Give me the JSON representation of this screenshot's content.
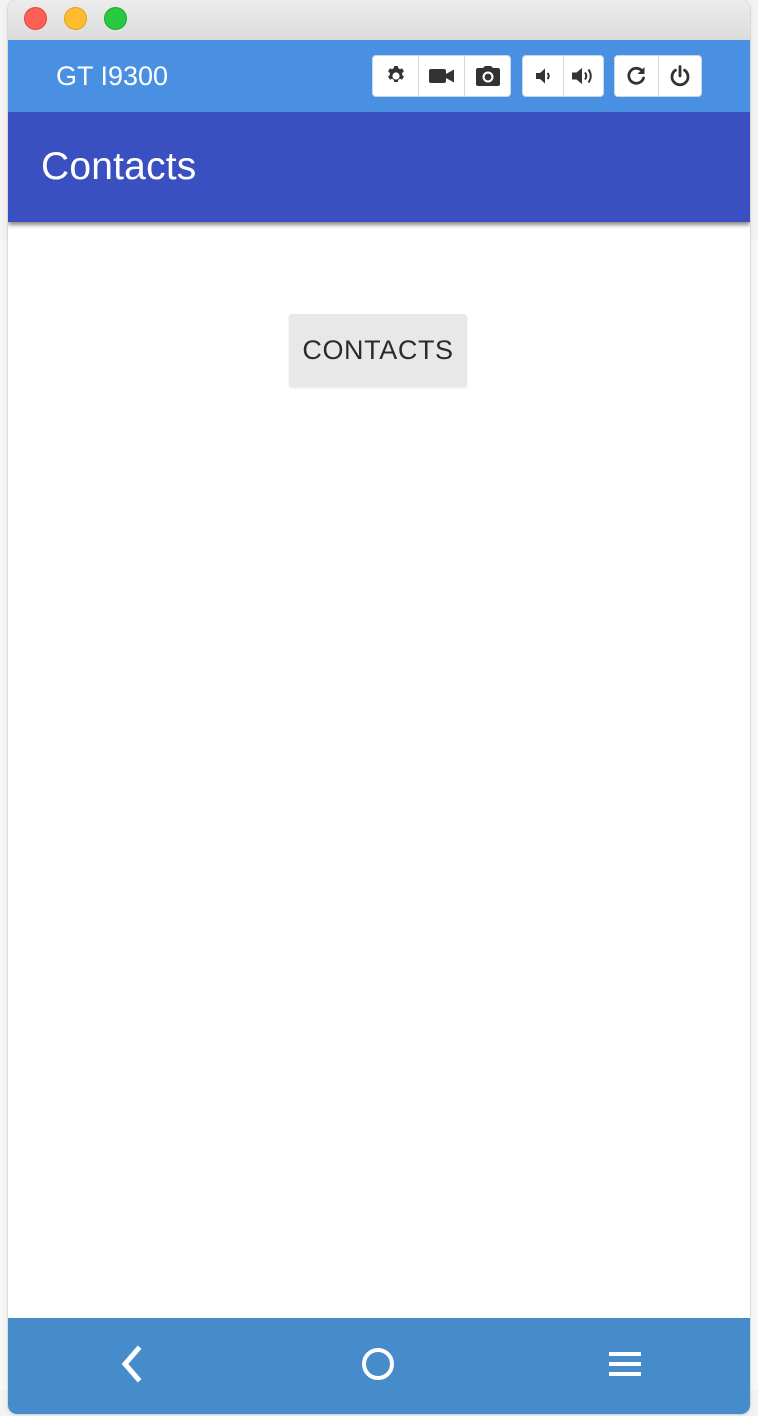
{
  "device": {
    "name": "GT I9300",
    "toolbar": {
      "groups": [
        {
          "buttons": [
            {
              "icon": "settings-icon"
            },
            {
              "icon": "video-camera-icon"
            },
            {
              "icon": "camera-icon"
            }
          ]
        },
        {
          "buttons": [
            {
              "icon": "volume-down-icon"
            },
            {
              "icon": "volume-up-icon"
            }
          ]
        },
        {
          "buttons": [
            {
              "icon": "rotate-icon"
            },
            {
              "icon": "power-icon"
            }
          ]
        }
      ]
    }
  },
  "app": {
    "title": "Contacts",
    "main_button_label": "CONTACTS"
  },
  "navigation": {
    "buttons": [
      {
        "icon": "back-icon"
      },
      {
        "icon": "home-icon"
      },
      {
        "icon": "menu-icon"
      }
    ]
  },
  "colors": {
    "device_bar": "#4a90e2",
    "app_bar": "#3a4fc0",
    "nav_bar": "#478cca",
    "button_background": "#e8e8e8"
  }
}
